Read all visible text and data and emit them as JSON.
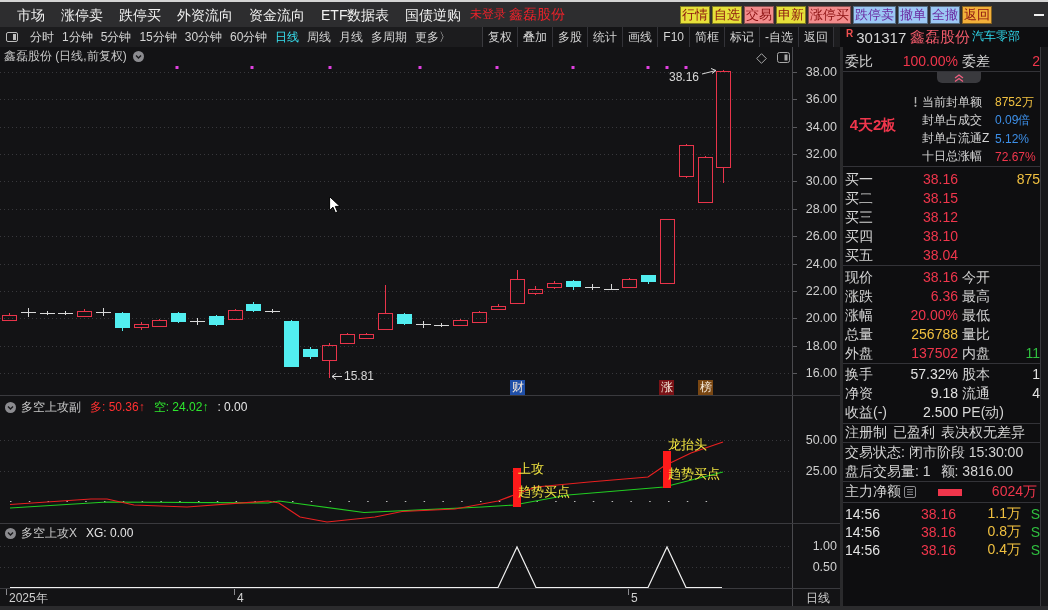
{
  "menu_bar": {
    "items": [
      "市场",
      "涨停卖",
      "跌停买",
      "外资流向",
      "资金流向",
      "ETF数据表",
      "国债逆购"
    ],
    "login_status": "未登录",
    "stock_name": "鑫磊股份",
    "quick_buttons": [
      {
        "label": "行情",
        "color": "#e6e03a"
      },
      {
        "label": "自选",
        "color": "#e6e03a"
      },
      {
        "label": "交易",
        "color": "#f28c8c"
      },
      {
        "label": "申新",
        "color": "#e6e03a"
      },
      {
        "label": "涨停买",
        "color": "#f28c8c"
      },
      {
        "label": "跌停卖",
        "color": "#9cc8f4"
      },
      {
        "label": "撤单",
        "color": "#9cc8f4"
      },
      {
        "label": "全撤",
        "color": "#9cc8f4"
      },
      {
        "label": "返回",
        "color": "#f2b03a"
      }
    ]
  },
  "toolbar": {
    "periods": [
      {
        "label": "分时",
        "selected": false
      },
      {
        "label": "1分钟",
        "selected": false
      },
      {
        "label": "5分钟",
        "selected": false
      },
      {
        "label": "15分钟",
        "selected": false
      },
      {
        "label": "30分钟",
        "selected": false
      },
      {
        "label": "60分钟",
        "selected": false
      },
      {
        "label": "日线",
        "selected": true
      },
      {
        "label": "周线",
        "selected": false
      },
      {
        "label": "月线",
        "selected": false
      },
      {
        "label": "多周期",
        "selected": false
      },
      {
        "label": "更多〉",
        "selected": false
      }
    ],
    "buttons": [
      "复权",
      "叠加",
      "多股",
      "统计",
      "画线",
      "F10",
      "简框",
      "标记",
      "-自选",
      "返回"
    ]
  },
  "quote_header": {
    "flag": "R",
    "code": "301317",
    "name": "鑫磊股份",
    "industry": "汽车零部"
  },
  "kline_chart": {
    "title": "鑫磊股份 (日线,前复权)",
    "price_axis": [
      "38.00",
      "36.00",
      "34.00",
      "32.00",
      "30.00",
      "28.00",
      "26.00",
      "24.00",
      "22.00",
      "20.00",
      "18.00",
      "16.00"
    ],
    "high_label": "38.16",
    "low_label": "15.81",
    "markers": [
      {
        "label": "财",
        "color": "#1f4fa8"
      },
      {
        "label": "涨",
        "color": "#7a1216"
      },
      {
        "label": "榜",
        "color": "#7a4712"
      }
    ]
  },
  "indicators": [
    {
      "kind": "lines",
      "name": "多空上攻副",
      "readouts": [
        {
          "text": "多: 50.36↑",
          "color": "#ff3030"
        },
        {
          "text": "空: 24.02↑",
          "color": "#2ee62e"
        },
        {
          "text": ": 0.00",
          "color": "#e6e6e6"
        }
      ],
      "axis": [
        "50.00",
        "25.00"
      ],
      "signals": [
        {
          "labels": [
            "上攻",
            "趋势买点"
          ]
        },
        {
          "labels": [
            "龙抬头",
            "趋势买点"
          ]
        }
      ]
    },
    {
      "kind": "pulse",
      "name": "多空上攻X",
      "readouts": [
        {
          "text": "XG: 0.00",
          "color": "#e6e6e6"
        }
      ],
      "axis": [
        "1.00",
        "0.50"
      ]
    }
  ],
  "time_axis": {
    "labels": [
      "2025年",
      "4",
      "5"
    ],
    "period": "日线"
  },
  "quote_panel": {
    "order_ratio": {
      "label": "委比",
      "value": "100.00%",
      "diff_label": "委差",
      "diff_value": "2"
    },
    "limit_info": {
      "streak": "4天2板",
      "rows": [
        {
          "label": "当前封单额",
          "value": "8752万",
          "color": "#f0c040",
          "alert": true
        },
        {
          "label": "封单占成交",
          "value": "0.09倍",
          "color": "#3d8fe8",
          "alert": false
        },
        {
          "label": "封单占流通Z",
          "value": "5.12%",
          "color": "#3d8fe8",
          "alert": false
        },
        {
          "label": "十日总涨幅",
          "value": "72.67%",
          "color": "#f0364c",
          "alert": false
        }
      ]
    },
    "bids": [
      {
        "label": "买一",
        "price": "38.16",
        "volume": "875"
      },
      {
        "label": "买二",
        "price": "38.15"
      },
      {
        "label": "买三",
        "price": "38.12"
      },
      {
        "label": "买四",
        "price": "38.10"
      },
      {
        "label": "买五",
        "price": "38.04"
      }
    ],
    "quotes": [
      {
        "label": "现价",
        "value": "38.16",
        "color": "#f0364c",
        "label2": "今开"
      },
      {
        "label": "涨跌",
        "value": "6.36",
        "color": "#f0364c",
        "label2": "最高"
      },
      {
        "label": "涨幅",
        "value": "20.00%",
        "color": "#f0364c",
        "label2": "最低"
      },
      {
        "label": "总量",
        "value": "256788",
        "color": "#f0c040",
        "label2": "量比"
      },
      {
        "label": "外盘",
        "value": "137502",
        "color": "#f0364c",
        "label2": "内盘",
        "value2": {
          "text": "11",
          "color": "#2fbf3f"
        }
      }
    ],
    "fundamentals": [
      {
        "label": "换手",
        "value": "57.32%",
        "label2": "股本",
        "value2": "1"
      },
      {
        "label": "净资",
        "value": "9.18",
        "label2": "流通",
        "value2": "4"
      },
      {
        "label": "收益(-)",
        "value": "2.500",
        "label2": "PE(动)"
      }
    ],
    "tags": [
      "注册制",
      "已盈利",
      "表决权无差异"
    ],
    "status_lines": [
      [
        "交易状态: 闭市阶段 15:30:00"
      ],
      [
        "盘后交易量: 1",
        "额: 3816.00"
      ]
    ],
    "main_net": {
      "label": "主力净额",
      "value": "6024万"
    },
    "ticks": [
      {
        "time": "14:56",
        "price": "38.16",
        "volume": "1.1万",
        "side": "S"
      },
      {
        "time": "14:56",
        "price": "38.16",
        "volume": "0.8万",
        "side": "S"
      },
      {
        "time": "14:56",
        "price": "38.16",
        "volume": "0.4万",
        "side": "S"
      }
    ]
  }
}
